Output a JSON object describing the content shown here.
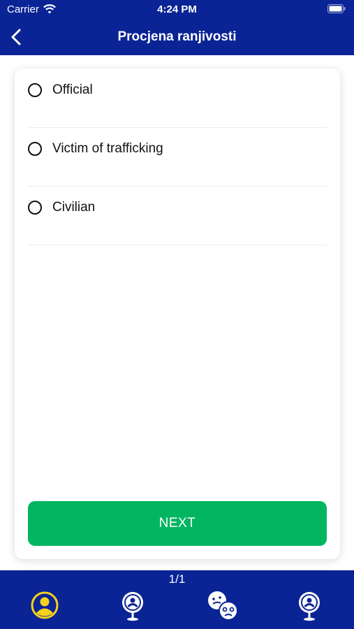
{
  "status_bar": {
    "carrier": "Carrier",
    "time": "4:24 PM"
  },
  "header": {
    "title": "Procjena ranjivosti",
    "back_icon": "chevron-left-icon"
  },
  "options": [
    {
      "label": "Official",
      "selected": false
    },
    {
      "label": "Victim of trafficking",
      "selected": false
    },
    {
      "label": "Civilian",
      "selected": false
    }
  ],
  "next_button": {
    "label": "NEXT"
  },
  "pager": {
    "text": "1/1"
  },
  "tabs": [
    {
      "icon": "user-profile-icon",
      "active": true
    },
    {
      "icon": "user-location-icon",
      "active": false
    },
    {
      "icon": "emotion-faces-icon",
      "active": false
    },
    {
      "icon": "user-location-icon",
      "active": false
    }
  ],
  "colors": {
    "primary_blue": "#0a2496",
    "accent_green": "#02b561",
    "active_tab_yellow": "#f7d21c"
  }
}
